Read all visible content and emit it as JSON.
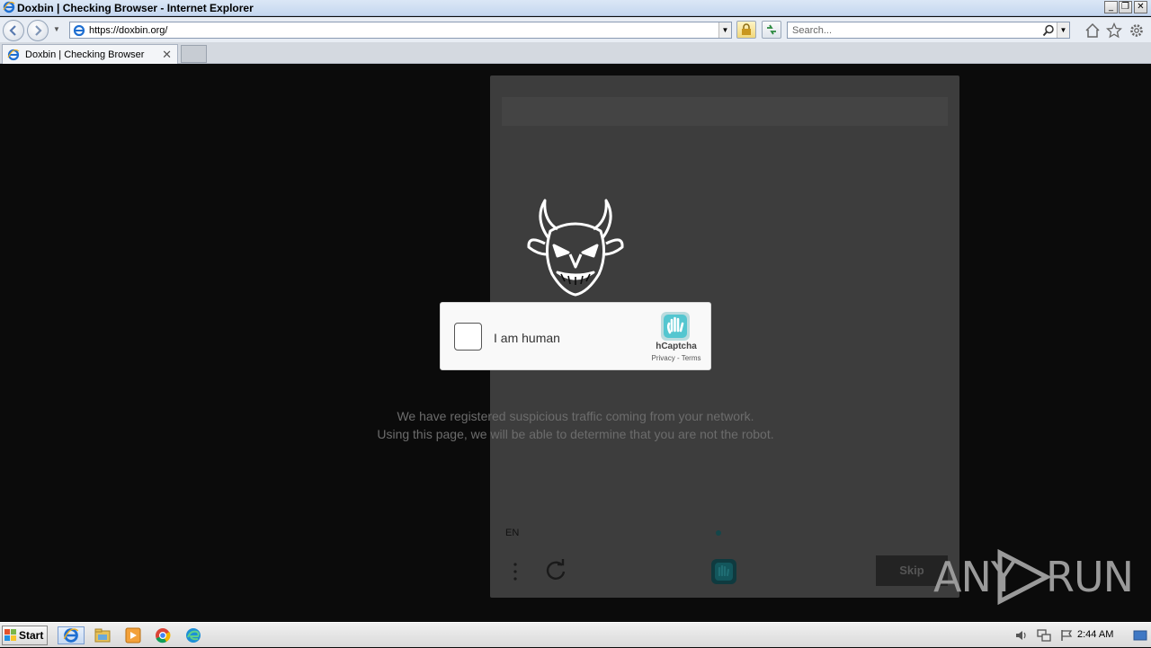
{
  "window": {
    "title": "Doxbin | Checking Browser - Internet Explorer",
    "controls": [
      "minimize",
      "restore",
      "close"
    ]
  },
  "navbar": {
    "url": "https://doxbin.org/",
    "search_placeholder": "Search...",
    "icons": [
      "back-icon",
      "forward-icon",
      "lock-icon",
      "refresh-icon",
      "home-icon",
      "favorites-star-icon",
      "settings-gear-icon"
    ]
  },
  "tabs": [
    {
      "label": "Doxbin | Checking Browser",
      "active": true
    }
  ],
  "challenge": {
    "captcha_label": "I am human",
    "brand": "hCaptcha",
    "links": "Privacy - Terms",
    "language": "EN",
    "skip_label": "Skip"
  },
  "notice": {
    "line1": "We have registered suspicious traffic coming from your network.",
    "line2": "Using this page, we will be able to determine that you are not the robot."
  },
  "watermark": {
    "left": "ANY",
    "right": "RUN"
  },
  "taskbar": {
    "start_label": "Start",
    "clock": "2:44 AM",
    "apps": [
      "internet-explorer",
      "file-explorer",
      "media-player",
      "chrome",
      "edge"
    ]
  },
  "colors": {
    "page_bg": "#0b0b0b",
    "panel_bg": "#3d3d3d",
    "hcaptcha_teal": "#00838f"
  }
}
